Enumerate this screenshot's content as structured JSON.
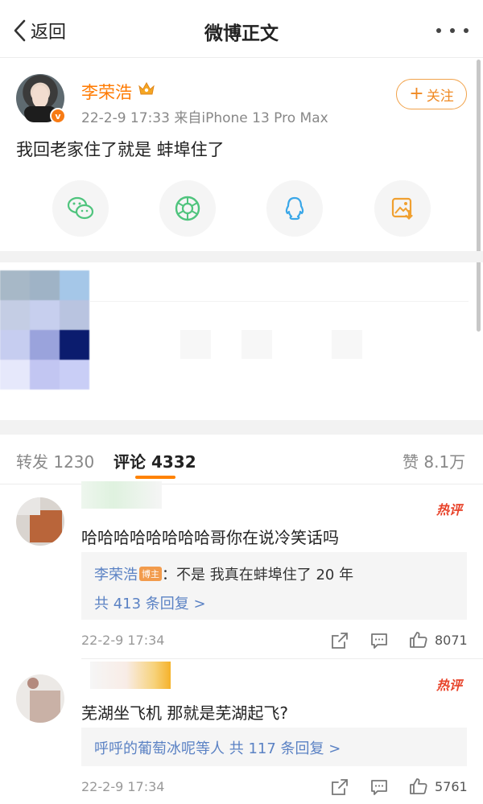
{
  "header": {
    "back_label": "返回",
    "title": "微博正文"
  },
  "post": {
    "author": "李荣浩",
    "timestamp": "22-2-9 17:33",
    "source": "来自iPhone 13 Pro Max",
    "follow_label": "关注",
    "follow_plus": "+",
    "verified_mark": "v",
    "content": "我回老家住了就是 蚌埠住了",
    "share_targets": [
      "wechat-icon",
      "moments-icon",
      "qq-icon",
      "save-image-icon"
    ]
  },
  "tabs": {
    "repost_label": "转发",
    "repost_count": "1230",
    "comment_label": "评论",
    "comment_count": "4332",
    "like_label": "赞",
    "like_count": "8.1万"
  },
  "comments": [
    {
      "hot_label": "热评",
      "text": "哈哈哈哈哈哈哈哈哥你在说冷笑话吗",
      "reply_author": "李荣浩",
      "reply_badge": "博主",
      "reply_sep": "：",
      "reply_text": "不是 我真在蚌埠住了 20 年",
      "reply_more": "共 413 条回复 >",
      "time": "22-2-9 17:34",
      "likes": "8071"
    },
    {
      "hot_label": "热评",
      "text": "芜湖坐飞机 那就是芜湖起飞?",
      "reply_users": "呼呼的葡萄冰呢等人",
      "reply_more": "共 117 条回复 >",
      "time": "22-2-9 17:34",
      "likes": "5761"
    }
  ],
  "colors": {
    "accent_orange": "#ff8200",
    "author_orange": "#ff7a00",
    "link_blue": "#5b82c4",
    "hot_red": "#e8442b",
    "wechat_green": "#4fc47d",
    "qq_blue": "#3aa7e8",
    "save_orange": "#f0a030"
  }
}
